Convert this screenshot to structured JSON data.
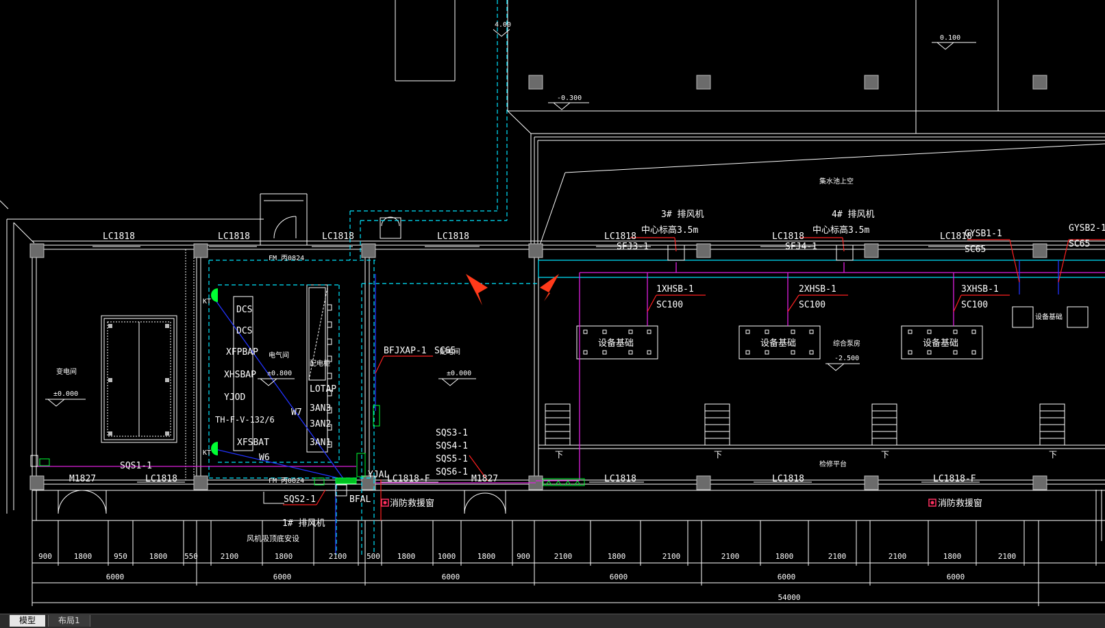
{
  "colors": {
    "background": "#000000",
    "wall": "#ffffff",
    "cyan_line": "#00e5ff",
    "magenta_line": "#e020e0",
    "blue_line": "#2233ff",
    "red_leader": "#ff2020",
    "green_device": "#00ff33",
    "red_arrow": "#ff3a1a"
  },
  "axis_labels": [
    "LC1818",
    "LC1818",
    "LC1818",
    "LC1818",
    "LC1818",
    "LC1818",
    "LC1818",
    "LC1818",
    "M1827",
    "LC1818",
    "LC1818-F",
    "M1827",
    "LC1818",
    "LC1818",
    "LC1818-F"
  ],
  "elevations": {
    "e1": "4.00",
    "e2": "-0.300",
    "e3": "0.100",
    "e4": "±0.000",
    "e5": "±0.800",
    "e6": "±0.000",
    "e7": "-2.500"
  },
  "fans": {
    "fan3_title": "3# 排风机",
    "fan3_height": "中心标高3.5m",
    "fan3_tag": "SFJ3-1",
    "fan4_title": "4# 排风机",
    "fan4_height": "中心标高3.5m",
    "fan4_tag": "SFJ4-1",
    "fan1_title": "1# 排风机",
    "fan1_note": "风机吸顶底安设"
  },
  "circuits": {
    "gysb1": "GYSB1-1",
    "gysb1_cable": "SC65",
    "gysb2": "GYSB2-1",
    "gysb2_cable": "SC65",
    "x1": "1XHSB-1",
    "x1_cable": "SC100",
    "x2": "2XHSB-1",
    "x2_cable": "SC100",
    "x3": "3XHSB-1",
    "x3_cable": "SC100",
    "bfjxap": "BFJXAP-1",
    "bfjxap_cable": "SC65",
    "sqs1": "SQS1-1",
    "sqs2": "SQS2-1",
    "sqs3": "SQS3-1",
    "sqs4": "SQS4-1",
    "sqs5": "SQS5-1",
    "sqs6": "SQS6-1",
    "yjal": "YJAL",
    "bfal": "BFAL",
    "w7": "W7",
    "w6": "W6"
  },
  "panels": [
    "DCS",
    "DCS",
    "XFPBAP",
    "XHSBAP",
    "YJOD",
    "TH-F-V-132/6",
    "XFSBAT"
  ],
  "panels_right": [
    "LOTAP",
    "3AN3",
    "3AN2",
    "3AN1"
  ],
  "room_labels": {
    "room1": "变电间",
    "room2": "电气间",
    "room3": "配电柜",
    "room4": "配电间",
    "equip": "设备基础",
    "equip_small": "设备基础",
    "platform": "检修平台",
    "upper": "集水池上空",
    "pool": "综合泵房"
  },
  "fire_window": "消防救援窗",
  "fm_door": "FM 丙0824",
  "down_label": "下",
  "kt": "KT",
  "dimensions_row1": [
    "900",
    "1800",
    "950",
    "1800",
    "550",
    "2100",
    "1800",
    "2100",
    "500",
    "1800",
    "1000",
    "1800",
    "900",
    "2100",
    "1800",
    "2100",
    "2100",
    "1800",
    "2100",
    "2100",
    "1800",
    "2100"
  ],
  "dimensions_row2": [
    "6000",
    "6000",
    "6000",
    "6000",
    "6000",
    "6000"
  ],
  "dimension_total": "54000",
  "tabs": [
    "模型",
    "布局1"
  ]
}
